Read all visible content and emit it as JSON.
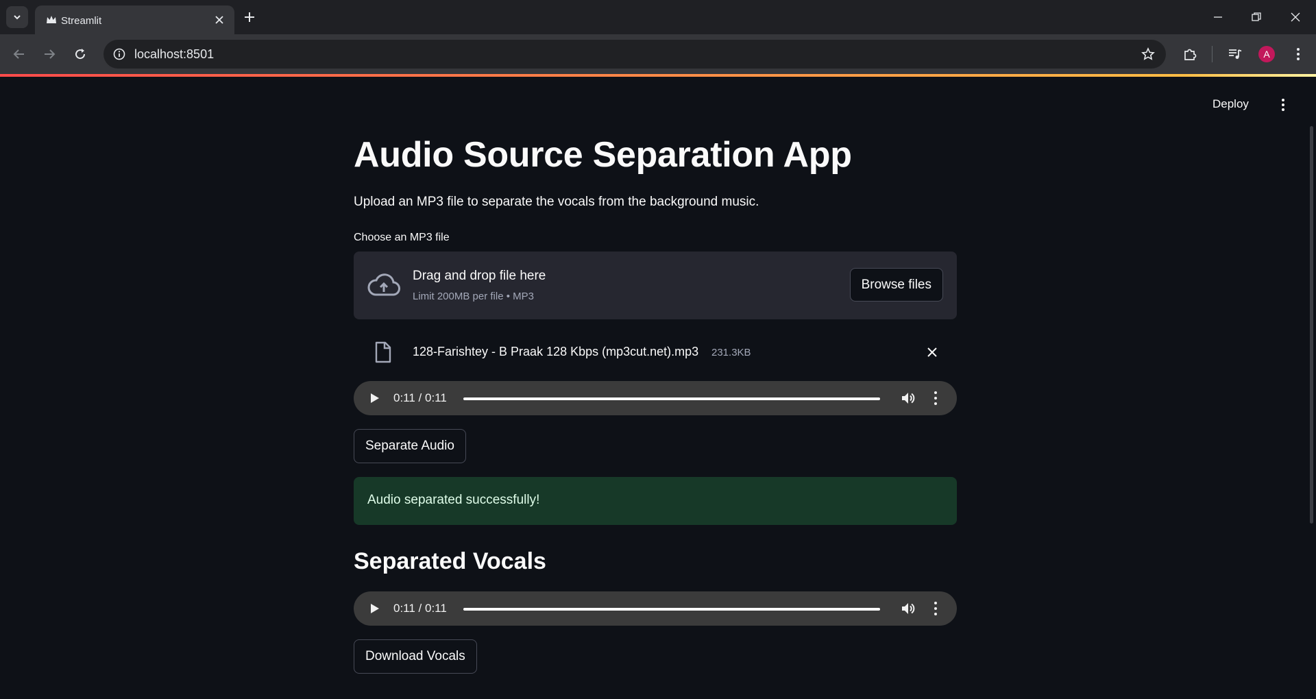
{
  "browser": {
    "tab_title": "Streamlit",
    "url": "localhost:8501",
    "avatar_letter": "A"
  },
  "header": {
    "deploy_label": "Deploy"
  },
  "main": {
    "title": "Audio Source Separation App",
    "subtitle": "Upload an MP3 file to separate the vocals from the background music.",
    "uploader": {
      "label": "Choose an MP3 file",
      "drop_text": "Drag and drop file here",
      "limit_text": "Limit 200MB per file • MP3",
      "browse_label": "Browse files"
    },
    "uploaded_file": {
      "name": "128-Farishtey - B Praak 128 Kbps (mp3cut.net).mp3",
      "size": "231.3KB"
    },
    "player1": {
      "time": "0:11 / 0:11",
      "progress": 1.0
    },
    "separate_button": "Separate Audio",
    "success_message": "Audio separated successfully!",
    "vocals_heading": "Separated Vocals",
    "player2": {
      "time": "0:11 / 0:11",
      "progress": 1.0
    },
    "download_button": "Download Vocals"
  },
  "colors": {
    "background": "#0e1117",
    "dropzone": "#262730",
    "success_bg": "#173928",
    "success_text": "#dffde9",
    "decoration_start": "#ff4b4b",
    "decoration_end": "#ffbd45"
  }
}
